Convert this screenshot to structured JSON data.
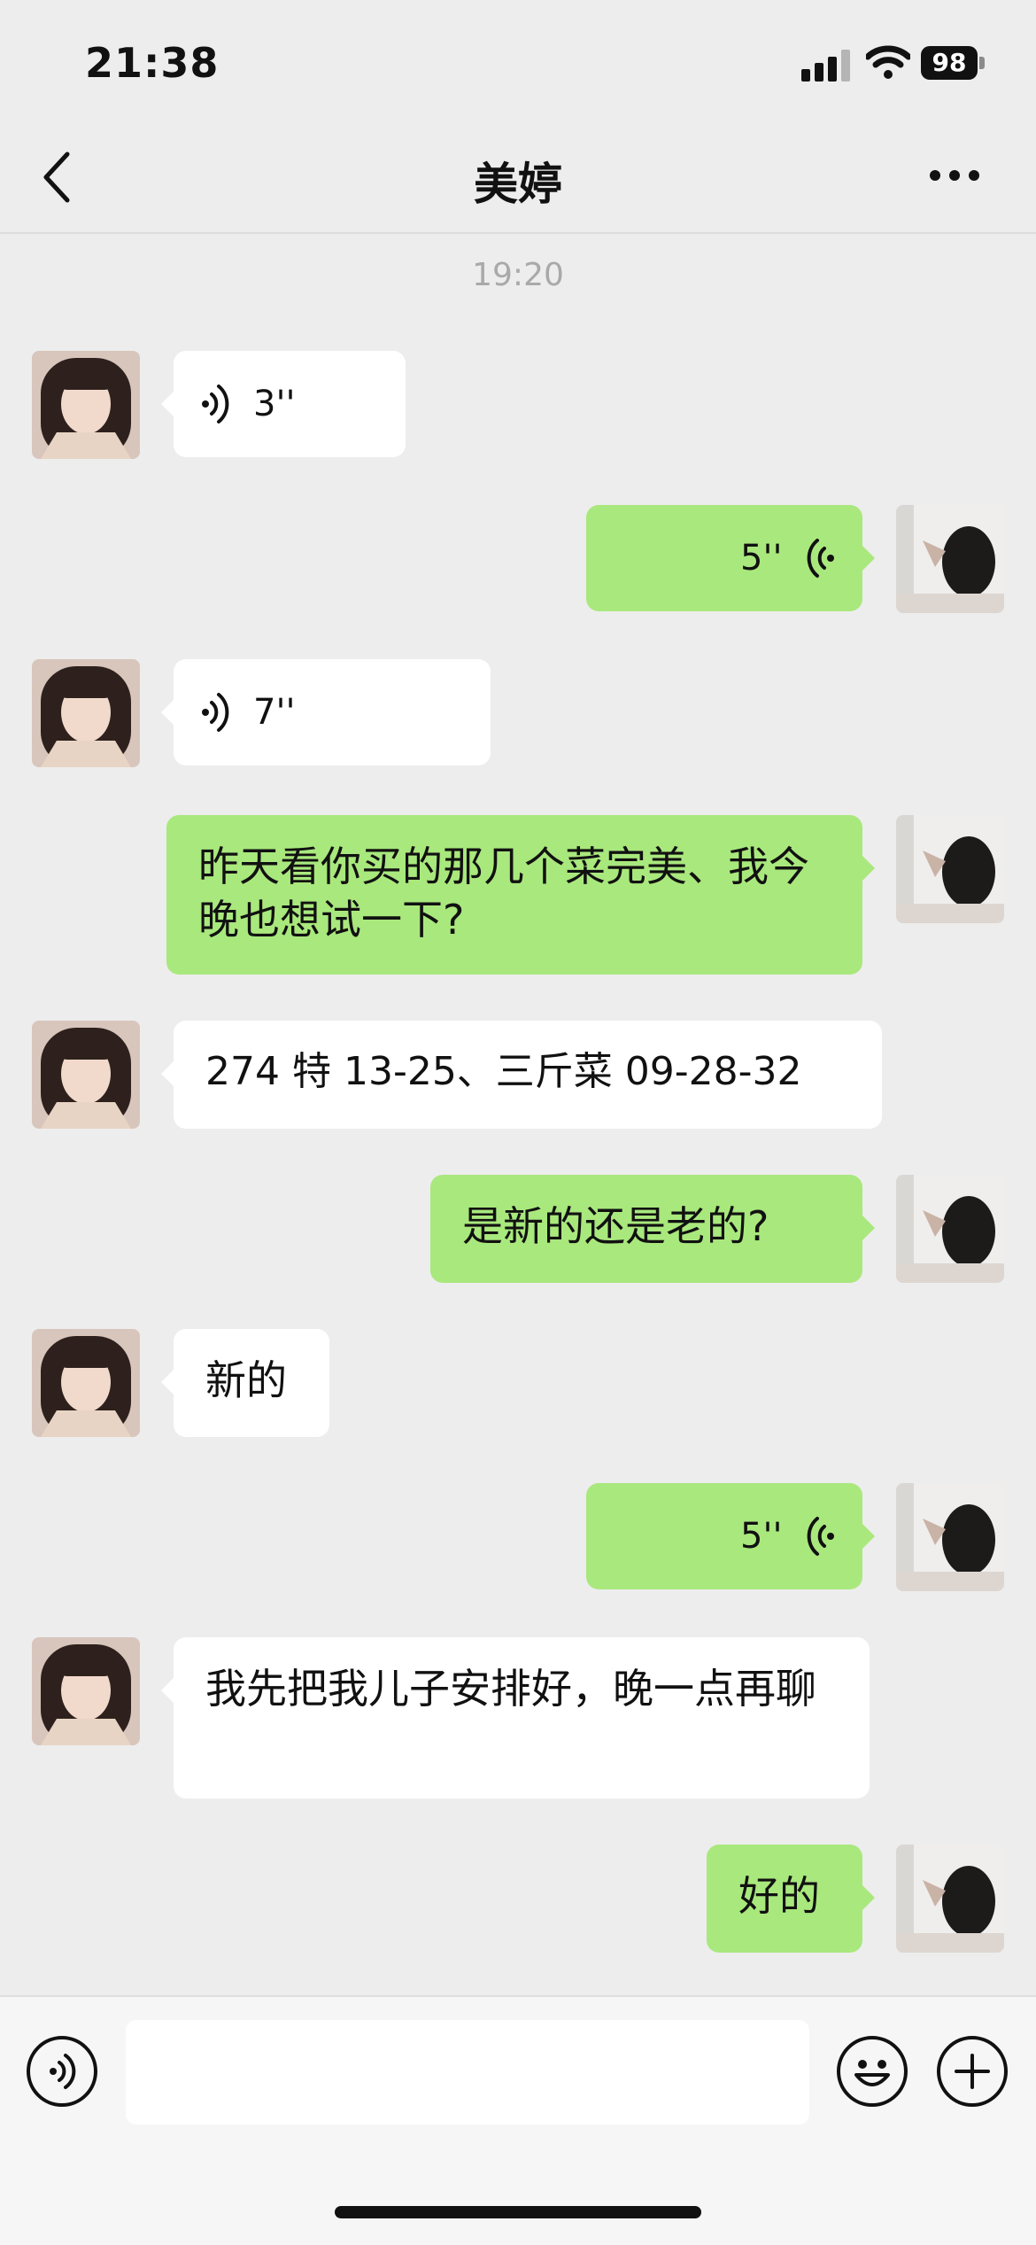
{
  "status_bar": {
    "time": "21:38",
    "battery": "98"
  },
  "header": {
    "title": "美婷",
    "back_icon": "chevron-left-icon",
    "more_icon": "more-dots-icon"
  },
  "chat": {
    "timestamp": "19:20",
    "messages": [
      {
        "side": "received",
        "type": "voice",
        "duration": "3''"
      },
      {
        "side": "sent",
        "type": "voice",
        "duration": "5''"
      },
      {
        "side": "received",
        "type": "voice",
        "duration": "7''"
      },
      {
        "side": "sent",
        "type": "text",
        "text": "昨天看你买的那几个菜完美、我今晚也想试一下?"
      },
      {
        "side": "received",
        "type": "text",
        "text": "274 特 13-25、三斤菜 09-28-32"
      },
      {
        "side": "sent",
        "type": "text",
        "text": "是新的还是老的?"
      },
      {
        "side": "received",
        "type": "text",
        "text": "新的"
      },
      {
        "side": "sent",
        "type": "voice",
        "duration": "5''"
      },
      {
        "side": "received",
        "type": "text",
        "text": "我先把我儿子安排好，晚一点再聊"
      },
      {
        "side": "sent",
        "type": "text",
        "text": "好的"
      }
    ]
  },
  "input_bar": {
    "voice_icon": "voice-mode-icon",
    "emoji_icon": "emoji-icon",
    "add_icon": "plus-icon",
    "value": ""
  },
  "colors": {
    "sent_bubble": "#a9e87d",
    "received_bubble": "#ffffff",
    "background": "#ededed"
  }
}
